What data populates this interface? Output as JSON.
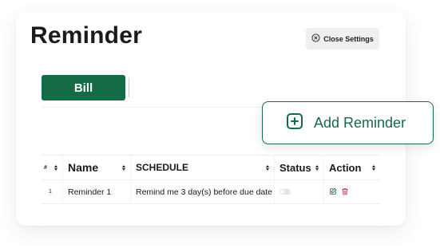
{
  "page": {
    "title": "Reminder",
    "close_settings_label": "Close Settings"
  },
  "tabs": [
    {
      "label": "Bill",
      "active": true
    }
  ],
  "add_reminder": {
    "label": "Add Reminder"
  },
  "table": {
    "columns": [
      "#",
      "Name",
      "SCHEDULE",
      "Status",
      "Action"
    ],
    "rows": [
      {
        "number": "1",
        "name": "Reminder 1",
        "schedule": "Remind me 3 day(s) before due date",
        "status_enabled": false
      }
    ]
  },
  "icons": {
    "close": "close-circle-icon",
    "add": "plus-square-icon",
    "sort": "sort-icon",
    "edit": "edit-icon",
    "delete": "trash-icon"
  },
  "colors": {
    "brand_green": "#146b46",
    "delete_red": "#d24646",
    "button_gray": "#f0efed"
  }
}
